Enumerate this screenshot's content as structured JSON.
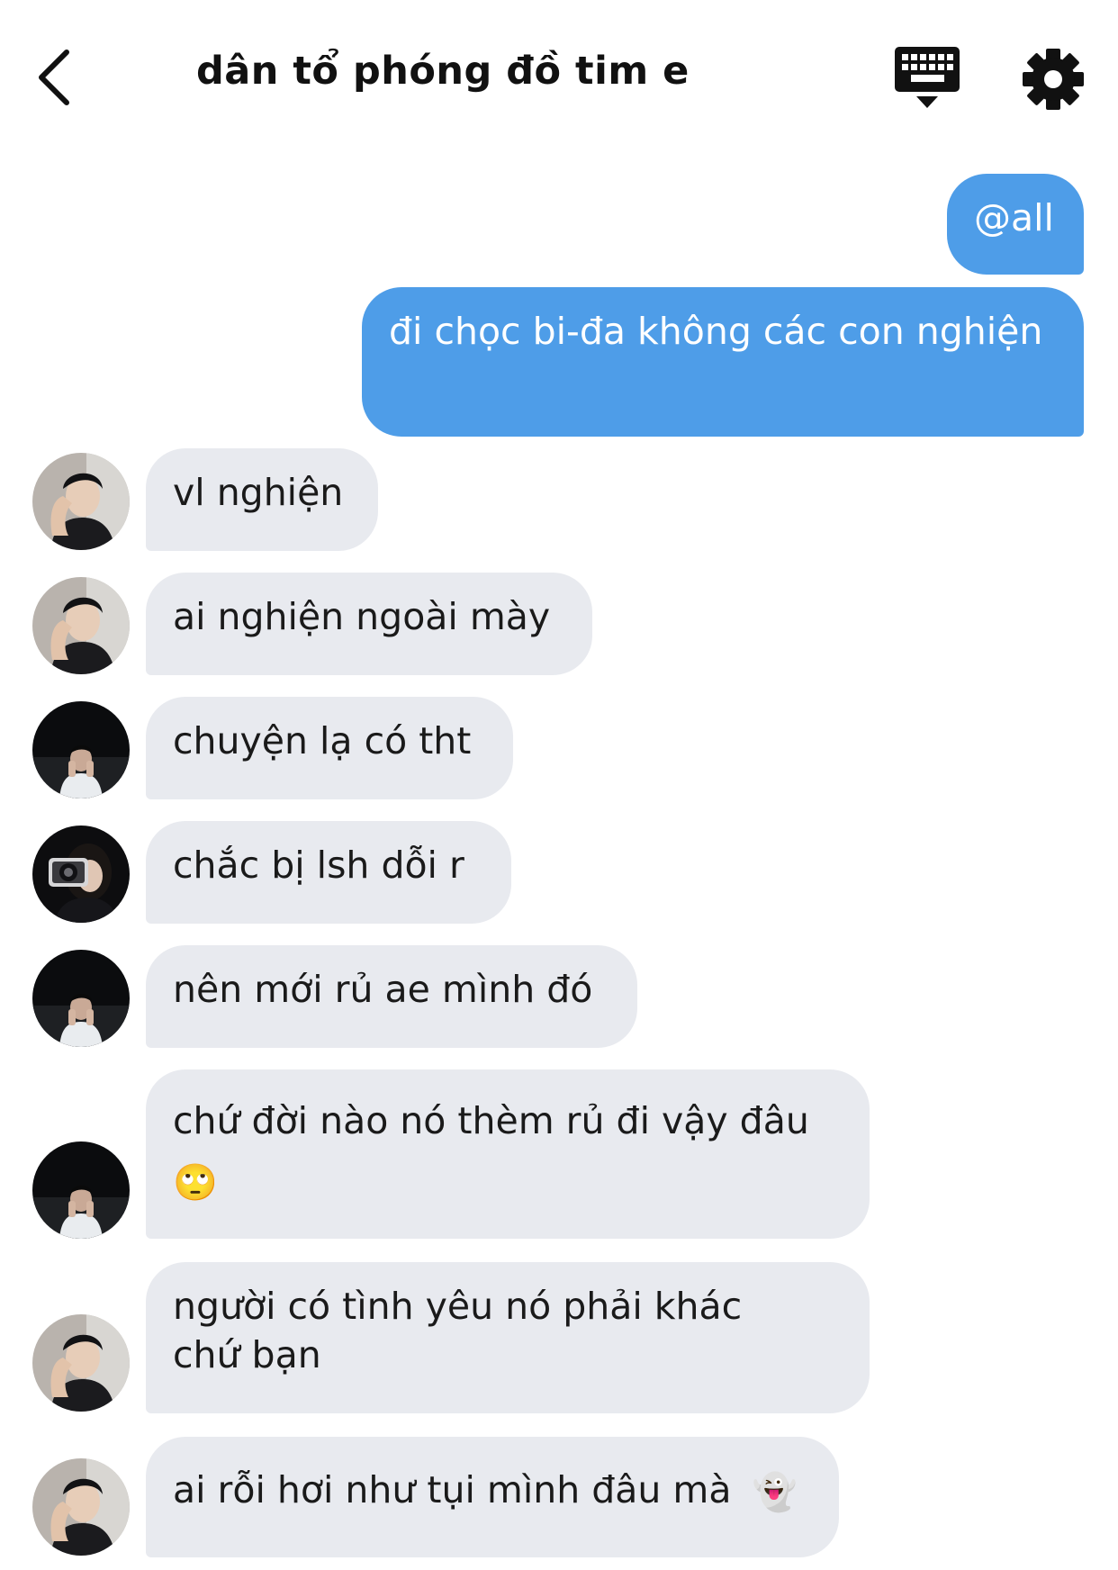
{
  "header": {
    "title": "dân tổ phóng đồ tim e",
    "back_icon": "chevron-left-icon",
    "keyboard_icon": "keyboard-icon",
    "settings_icon": "gear-icon"
  },
  "colors": {
    "outgoing_bubble": "#4e9de8",
    "incoming_bubble": "#e8eaef",
    "text_dark": "#1a1a1a"
  },
  "messages": [
    {
      "sender": "me",
      "text": "@all"
    },
    {
      "sender": "me",
      "text": "đi chọc bi-đa không các con nghiện"
    },
    {
      "sender": "friend-a",
      "avatar": "avatar-hand-on-face",
      "text": "vl nghiện"
    },
    {
      "sender": "friend-a",
      "avatar": "avatar-hand-on-face",
      "text": "ai nghiện ngoài mày"
    },
    {
      "sender": "friend-b",
      "avatar": "avatar-dark-beach",
      "text": "chuyện lạ có tht"
    },
    {
      "sender": "friend-c",
      "avatar": "avatar-camera",
      "text": "chắc bị lsh dỗi r"
    },
    {
      "sender": "friend-b",
      "avatar": "avatar-dark-beach",
      "text": "nên mới rủ ae mình đó"
    },
    {
      "sender": "friend-b",
      "avatar": "avatar-dark-beach",
      "text": "chứ đời nào nó thèm rủ đi vậy đâu",
      "emoji": "🙄",
      "emoji_icon": "eye-roll-emoji-icon"
    },
    {
      "sender": "friend-a",
      "avatar": "avatar-hand-on-face",
      "text": "người có tình yêu nó phải khác chứ bạn"
    },
    {
      "sender": "friend-a",
      "avatar": "avatar-hand-on-face",
      "text": "ai rỗi hơi như tụi mình đâu mà",
      "emoji": "👻",
      "emoji_icon": "ghost-emoji-icon"
    }
  ]
}
